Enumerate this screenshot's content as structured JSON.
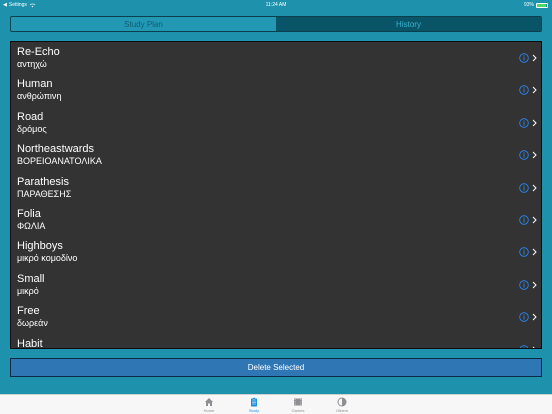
{
  "statusbar": {
    "carrier": "Settings",
    "time": "11:24 AM",
    "battery": "93%",
    "battery_level": 0.93
  },
  "segments": [
    {
      "label": "Study Plan",
      "active": false
    },
    {
      "label": "History",
      "active": true
    }
  ],
  "items": [
    {
      "title": "Re-Echo",
      "subtitle": "αντηχώ"
    },
    {
      "title": "Human",
      "subtitle": "ανθρώπινη"
    },
    {
      "title": "Road",
      "subtitle": "δρόμος"
    },
    {
      "title": "Northeastwards",
      "subtitle": "ΒΟΡΕΙΟΑΝΑΤΟΛΙΚΑ"
    },
    {
      "title": "Parathesis",
      "subtitle": "ΠΑΡΑΘΕΣΗΣ"
    },
    {
      "title": "Folia",
      "subtitle": "ΦΩΛΙΑ"
    },
    {
      "title": "Highboys",
      "subtitle": "μικρό κομοδίνο"
    },
    {
      "title": "Small",
      "subtitle": "μικρό"
    },
    {
      "title": "Free",
      "subtitle": "δωρεάν"
    },
    {
      "title": "Habit",
      "subtitle": ""
    }
  ],
  "delete_button": "Delete Selected",
  "tabbar": [
    {
      "label": "Home",
      "icon": "house-icon",
      "active": false
    },
    {
      "label": "Study",
      "icon": "clipboard-icon",
      "active": true
    },
    {
      "label": "Games",
      "icon": "film-icon",
      "active": false
    },
    {
      "label": "Others",
      "icon": "contrast-icon",
      "active": false
    }
  ],
  "colors": {
    "background": "#1e91ad",
    "list_background": "#333333",
    "info_icon": "#2a8cff",
    "delete_button": "#2f76b5",
    "tab_active": "#1a8ee0"
  }
}
